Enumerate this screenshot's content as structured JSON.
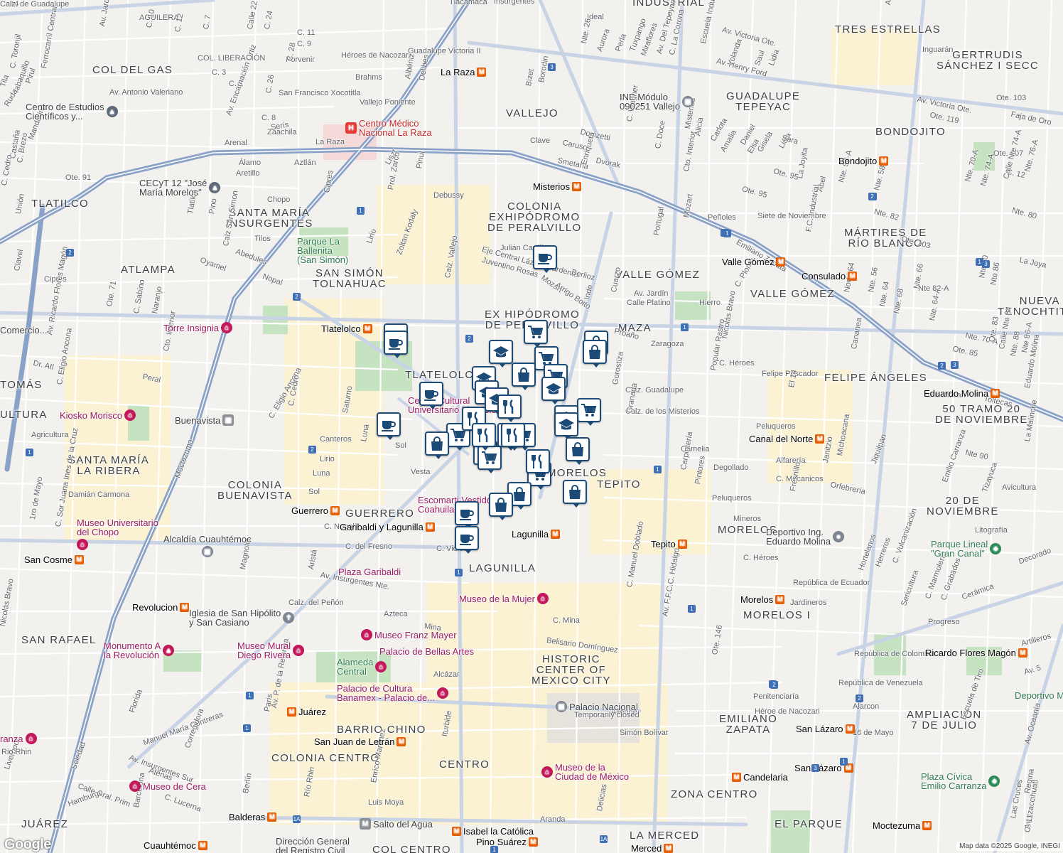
{
  "attribution": "Map data ©2025 Google, INEGI",
  "google_logo": "Google",
  "colors": {
    "road_major": "#b7c6de",
    "road_highway": "#8aa2c8",
    "park": "#c5e3c0",
    "urban_yellow": "#fbf1d3",
    "hospital": "#f5d9d9",
    "pin_border": "#1d4b77",
    "pin_icon": "#1d4b77",
    "metro": "#e65c00",
    "museum": "#c2185b"
  },
  "areas": [
    {
      "text": "COL DEL GAS",
      "emph": true
    },
    {
      "text": "INDUSTRIAL",
      "emph": true
    },
    {
      "text": "TRES ESTRELLAS",
      "emph": true
    },
    {
      "text": "GERTRUDIS\nSÁNCHEZ I SECC",
      "emph": true
    },
    {
      "text": "GUADALUPE\nTEPEYAC",
      "emph": true
    },
    {
      "text": "VALLEJO",
      "emph": true
    },
    {
      "text": "BONDOJITO",
      "emph": true
    },
    {
      "text": "TLATILCO",
      "emph": true
    },
    {
      "text": "SANTA MARÍA\nINSURGENTES",
      "emph": true
    },
    {
      "text": "COLONIA\nEXHIPÓDROMO\nDE PERALVILLO",
      "emph": true
    },
    {
      "text": "MÁRTIRES DE\nRÍO BLANCO",
      "emph": true
    },
    {
      "text": "ATLAMPA",
      "emph": true
    },
    {
      "text": "SAN SIMÓN\nTOLNAHUAC",
      "emph": true
    },
    {
      "text": "VALLE GÓMEZ",
      "emph": true
    },
    {
      "text": "VALLE GÓMEZ",
      "emph": true
    },
    {
      "text": "NUEVA\nTENOCHTITLA",
      "emph": true
    },
    {
      "text": "EX HIPÓDROMO\nDE PERALVILLO",
      "emph": true
    },
    {
      "text": "MAZA",
      "emph": true
    },
    {
      "text": "TLATELOLCO",
      "emph": true
    },
    {
      "text": "FELIPE ÁNGELES",
      "emph": true
    },
    {
      "text": "50 TRAMO 20\nDE NOVIEMBRE",
      "emph": true
    },
    {
      "text": "SANTA MARÍA\nLA RIBERA",
      "emph": true
    },
    {
      "text": "COLONIA\nBUENAVISTA",
      "emph": true
    },
    {
      "text": "GUERRERO",
      "emph": true
    },
    {
      "text": "MORELOS",
      "emph": true
    },
    {
      "text": "TEPITO",
      "emph": true
    },
    {
      "text": "20 DE\nNOVIEMBRE",
      "emph": true
    },
    {
      "text": "MORELOS",
      "emph": true
    },
    {
      "text": "LAGUNILLA",
      "emph": true
    },
    {
      "text": "SAN RAFAEL",
      "emph": true
    },
    {
      "text": "MORELOS I",
      "emph": true
    },
    {
      "text": "HISTORIC\nCENTER OF\nMEXICO CITY",
      "emph": true
    },
    {
      "text": "EMILIANO\nZAPATA",
      "emph": true
    },
    {
      "text": "BARRIO CHINO",
      "emph": true
    },
    {
      "text": "CENTRO",
      "emph": true
    },
    {
      "text": "COLONIA CENTRO",
      "emph": true
    },
    {
      "text": "AMPLIACIÓN\n7 DE JULIO",
      "emph": true
    },
    {
      "text": "ZONA CENTRO",
      "emph": true
    },
    {
      "text": "JUÁREZ",
      "emph": true
    },
    {
      "text": "LA MERCED",
      "emph": true
    },
    {
      "text": "EL PARQUE",
      "emph": true
    },
    {
      "text": "COL CENTRO",
      "emph": true
    },
    {
      "text": "TOMÁS",
      "emph": true
    },
    {
      "text": "ULTURA",
      "emph": true
    }
  ],
  "streets": [
    "AGUILERA",
    "C. 10",
    "C. 12",
    "C. 7",
    "Av. Jardín",
    "COL.\nLIBERACIÓN",
    "C. 3",
    "C. 1",
    "Calle 22",
    "C. 24",
    "C. 11",
    "C. 9",
    "Héroes de\nNacozari",
    "Porvenir",
    "Brahms",
    "Guadalupe\nVictoria II",
    "Tlacamaca",
    "Insurgentes",
    "Ideal",
    "Nte. 26",
    "Aurora",
    "Perla",
    "Tuxpango",
    "Miraflores",
    "Av. Del Tepeyac",
    "C. La Corona",
    "Escuela Industrial",
    "Av. Victoria Ote.",
    "Av. Henry Ford",
    "Yolanda",
    "Saul",
    "Lidia",
    "Aragón",
    "Inguarán",
    "C. Toronjil",
    "Tila",
    "Ferrocarril Central",
    "Pirul",
    "Tabaquillo",
    "Ruda",
    "Av. Antonio Valeriano",
    "San Francisco\nXocotitla",
    "C. 26",
    "C. 28",
    "Vallejo\nPoniente",
    "Albéniz",
    "Delibes",
    "Bizet",
    "Borodin",
    "Clave",
    "Caruso",
    "Donizetti",
    "Smetana",
    "Dvorak",
    "C. Wagner",
    "Enriqueta",
    "Av. Victoria Ote.",
    "Ote. 119",
    "Ote. 103",
    "Faja de Oro",
    "Ote. 107",
    "C. 12",
    "C. 8",
    "Zaachila",
    "Serís",
    "La Raza",
    "Arenal",
    "Álamo",
    "Aretillo",
    "Mandarina",
    "Castaña",
    "C. Brezo",
    "C. Cedro",
    "Av. Encarnación Ortiz",
    "Aztlán",
    "Cipres",
    "Pinul",
    "Debussy",
    "Liszt",
    "Cto. Interior",
    "Misterios",
    "Alicia",
    "Carlota",
    "Amalia",
    "Daniel",
    "Elsa",
    "Gisela",
    "Lidia",
    "Sara",
    "La Joyita",
    "Ote. 95",
    "Ote. 95",
    "Abel",
    "Nte. 54-A",
    "Nte. 58",
    "Nte. 70-A",
    "Nte. 74-A",
    "Calle Nte 74-A",
    "Nte. 76-A",
    "Nte. 80",
    "Nte. 82",
    "Ote. 103",
    "Ote. 91",
    "Unión",
    "Tlatilco",
    "Pino",
    "Chopo",
    "Tilos",
    "Abedules",
    "Calz San Simon",
    "Oyamel",
    "Nopal",
    "Lirio",
    "Zoltan Kodaly",
    "Prol. Zarco",
    "Calz. Vallejo",
    "Eje Central Lázaro Cárdenas",
    "Juventino Rosas",
    "Julián Carrillo",
    "Mozart",
    "Arrigo Boito",
    "Berlioz",
    "Mozart",
    "Portugal",
    "Peñoles",
    "Siete de\nNoviembre",
    "Emiliano\nZapata",
    "F.C. Industrial",
    "Nte. 56",
    "Nte. 64",
    "Norte 64",
    "Nte. 66",
    "Nte. 68",
    "Nte. 64-A",
    "Nte. 70-A",
    "Ote. 85",
    "Ote. 83",
    "Calle Nte 84",
    "Nte 86-A",
    "Nte. 88",
    "Nte 86",
    "Nte 80",
    "Nte 82-A",
    "La Joya",
    "Ote. 71",
    "C. Sabino",
    "Naranjo",
    "Cipres",
    "Clavel",
    "Av. Jardín",
    "Calle Platino",
    "Hierro",
    "C. Plomo",
    "Proaño",
    "Cto. Interior",
    "Av. Ricardo Flores Magón",
    "Dr. Atl",
    "Peral",
    "C. Eligio Ancona",
    "C. Eligio Ancona",
    "C. Cedro",
    "Saturno",
    "Zaragoza",
    "C. Héroes",
    "Felipe\nPescador",
    "Nicolás Bravo",
    "Popular Rastro",
    "Cananea",
    "El 14",
    "Cuarzo",
    "Inde",
    "Calz. Guadalupe",
    "Calz. de los Misterios",
    "Gorostiza",
    "Granada",
    "Tenochtitlan",
    "Toltecas",
    "Eduardo Molina",
    "La Malinche",
    "Nte 90",
    "Agricultura",
    "Canteros",
    "Lirio",
    "Luna",
    "Sol",
    "Vesta",
    "Luna",
    "Sol",
    "Camelia",
    "Degollado",
    "Pintores",
    "Peluqueros",
    "Carpintería",
    "Mineros",
    "Alfarería",
    "C. Mecanicos",
    "Janitzio",
    "Michoacana",
    "Orfebrería",
    "Fresnillo",
    "Peluqueros",
    "Jiquilpan",
    "Emilio\nCarranza",
    "Tizayuca",
    "Litografía",
    "Avicultura",
    "Damián\nCarmona",
    "1ro de Mayo",
    "C. Sor Juana Ines de la Cruz",
    "C. Nogal",
    "C. del Fresno",
    "Moctezuma",
    "Magnolia",
    "Av. Insurgentes Nte.",
    "Aristá",
    "C. Violeta",
    "C. Héroes",
    "República de Ecuador",
    "Jardineros",
    "Hortelanos",
    "Herreros",
    "C. Vulcanización",
    "Sericultura",
    "C. Marmolería",
    "C. Grabados",
    "Decorado",
    "Cerámica",
    "Progreso",
    "Calz. del Peñón",
    "Azteca",
    "Mina",
    "C. Mina",
    "Belisario Domínguez",
    "República de Colombia",
    "República de Venezuela",
    "Penitenciaría",
    "Héroe de Nacozari",
    "Alarcon",
    "16 de Mayo",
    "Escuela\nde Tiro",
    "Artilleros",
    "Av. 5",
    "Av. Oceanía",
    "Av. F.F.C.C. Hidalgo",
    "Ote. 146",
    "C. Manuel Doblado",
    "Nicolás Bravo",
    "Florida",
    "Manuel María Contreras",
    "Paris",
    "Av. P. de la Reforma",
    "Alcázar",
    "Iturbide",
    "Allende",
    "Simón Bolívar",
    "Soledad",
    "Corregidora",
    "Av. Insurgentes Sur",
    "Atenas",
    "Calle Gral. Prim",
    "C. Lucerna",
    "Hamburgo",
    "Barcelona",
    "Liverpool",
    "Berlín",
    "Río Rhin",
    "Enrico Martínez",
    "Luis Moya",
    "Aranda",
    "Delicias",
    "Regina",
    "Las Cruces",
    "Av. Izaccihuatl",
    "C. 11",
    "C. Doce",
    "C. 14",
    "Calz. de Guadalupe"
  ],
  "pois": [
    {
      "label": "La Raza",
      "kind": "metro"
    },
    {
      "label": "Centro Médico\nNacional La Raza",
      "kind": "hosp"
    },
    {
      "label": "Centro de Estudios\nCientíficos y...",
      "kind": "school"
    },
    {
      "label": "INE Módulo\n090251 Vallejo",
      "kind": "gov"
    },
    {
      "label": "Bondojito",
      "kind": "metro"
    },
    {
      "label": "CECyT 12 \"José\nMaría Morelos\"",
      "kind": "school"
    },
    {
      "label": "Parque La\nBallenita\n(San Simón)",
      "kind": "park"
    },
    {
      "label": "Misterios",
      "kind": "metro"
    },
    {
      "label": "Valle Gómez",
      "kind": "metro"
    },
    {
      "label": "Consulado",
      "kind": "metro"
    },
    {
      "label": "Torre Insignia",
      "kind": "museum"
    },
    {
      "label": "Tlatelolco",
      "kind": "metro"
    },
    {
      "label": "Comercio...",
      "kind": "plain"
    },
    {
      "label": "Kiosko Morisco",
      "kind": "museum"
    },
    {
      "label": "Buenavista",
      "kind": "transit"
    },
    {
      "label": "Centro Cultural\nUniversitario Tlatelolco",
      "kind": "museum"
    },
    {
      "label": "Eduardo Molina",
      "kind": "metro"
    },
    {
      "label": "Canal del Norte",
      "kind": "metro"
    },
    {
      "label": "Guerrero",
      "kind": "metro"
    },
    {
      "label": "Escomarti Vestidos\nCoahuila",
      "kind": "museum"
    },
    {
      "label": "Garibaldi y Lagunilla",
      "kind": "metro"
    },
    {
      "label": "Lagunilla",
      "kind": "metro"
    },
    {
      "label": "Tepito",
      "kind": "metro"
    },
    {
      "label": "Museo Universitario\ndel Chopo",
      "kind": "museum"
    },
    {
      "label": "Alcaldía Cuauhtémoc",
      "kind": "gov"
    },
    {
      "label": "Deportivo Ing.\nEduardo Molina",
      "kind": "gov"
    },
    {
      "label": "Parque Lineal\n\"Gran Canal\"",
      "kind": "park"
    },
    {
      "label": "San Cosme",
      "kind": "metro"
    },
    {
      "label": "Plaza Garibaldi",
      "kind": "museum"
    },
    {
      "label": "Museo de la Mujer",
      "kind": "museum"
    },
    {
      "label": "Morelos",
      "kind": "metro"
    },
    {
      "label": "Revolucion",
      "kind": "metro"
    },
    {
      "label": "Iglesia de San Hipólito\ny San Casiano",
      "kind": "gov"
    },
    {
      "label": "Museo Franz Mayer",
      "kind": "museum"
    },
    {
      "label": "Monumento A\nla Revolución",
      "kind": "museum"
    },
    {
      "label": "Museo Mural\nDiego Rivera",
      "kind": "museum"
    },
    {
      "label": "Palacio de Bellas Artes",
      "kind": "museum"
    },
    {
      "label": "Alameda\nCentral",
      "kind": "museum"
    },
    {
      "label": "Ricardo Flores Magón",
      "kind": "metro"
    },
    {
      "label": "Palacio de Cultura\nBanamex - Palacio de...",
      "kind": "museum"
    },
    {
      "label": "Palacio Nacional",
      "kind": "gov"
    },
    {
      "label": "Temporarily closed",
      "kind": "plain"
    },
    {
      "label": "Deportivo M",
      "kind": "park"
    },
    {
      "label": "Juárez",
      "kind": "metro"
    },
    {
      "label": "San Juan de Letrán",
      "kind": "metro"
    },
    {
      "label": "San Lázaro",
      "kind": "metro"
    },
    {
      "label": "San Lázaro",
      "kind": "metro"
    },
    {
      "label": "Museo de la\nCiudad de México",
      "kind": "museum"
    },
    {
      "label": "Candelaria",
      "kind": "metro"
    },
    {
      "label": "Plaza Cívica\nEmilio Carranza",
      "kind": "park"
    },
    {
      "label": "Museo de Cera",
      "kind": "museum"
    },
    {
      "label": "ranza",
      "kind": "museum"
    },
    {
      "label": "Salto del Agua",
      "kind": "transit"
    },
    {
      "label": "Isabel la Católica",
      "kind": "metro"
    },
    {
      "label": "Pino Suárez",
      "kind": "metro"
    },
    {
      "label": "Balderas",
      "kind": "metro"
    },
    {
      "label": "Cuauhtémoc",
      "kind": "metro"
    },
    {
      "label": "Dirección General\ndel Registro Civil",
      "kind": "gov"
    },
    {
      "label": "Merced",
      "kind": "metro"
    },
    {
      "label": "Moctezuma",
      "kind": "metro"
    },
    {
      "label": "Rio Rhin",
      "kind": "plain"
    }
  ],
  "shields": [
    "3",
    "2",
    "2",
    "1",
    "1",
    "2",
    "2",
    "1",
    "1",
    "2",
    "1",
    "2",
    "1",
    "1",
    "1",
    "3",
    "2",
    "3",
    "1",
    "1",
    "1A",
    "1A",
    "1",
    "1",
    "2",
    "3",
    "3",
    "2",
    "1"
  ],
  "pins": [
    "coffee",
    "coffee",
    "coffee",
    "coffee",
    "coffee",
    "coffee",
    "coffee",
    "cart",
    "cart",
    "cart",
    "cart",
    "cart",
    "cart",
    "cart",
    "cart",
    "cart",
    "school",
    "school",
    "school",
    "school",
    "school",
    "school",
    "school",
    "fork",
    "fork",
    "fork",
    "fork",
    "fork",
    "fork",
    "bag",
    "bag",
    "bag",
    "bag",
    "bag",
    "bag",
    "bag",
    "bag"
  ]
}
